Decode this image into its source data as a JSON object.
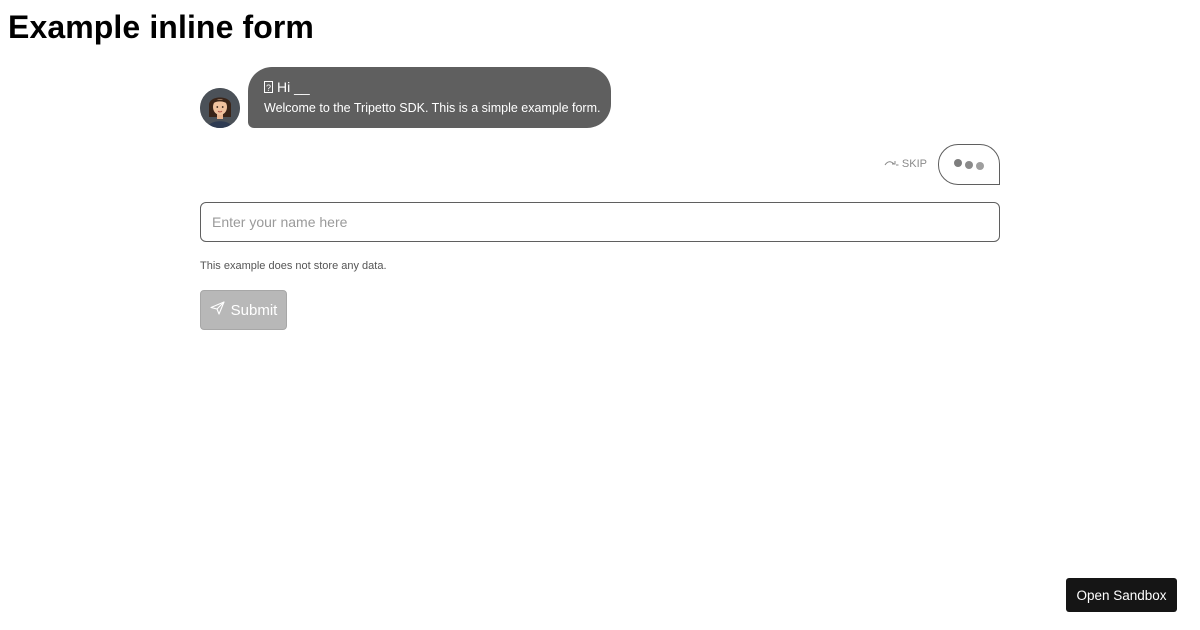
{
  "page": {
    "title": "Example inline form"
  },
  "form": {
    "bubble": {
      "greeting_glyph": "?",
      "greeting": "Hi __",
      "welcome": "Welcome to the Tripetto SDK. This is a simple example form."
    },
    "skip_label": "SKIP",
    "name_input": {
      "placeholder": "Enter your name here",
      "value": ""
    },
    "note": "This example does not store any data.",
    "submit_label": "Submit"
  },
  "sandbox": {
    "label": "Open Sandbox"
  },
  "icons": {
    "avatar": "avatar-icon",
    "skip": "skip-icon",
    "typing": "typing-indicator-icon",
    "submit": "paper-plane-icon"
  },
  "colors": {
    "bubble": "#5f5f5f",
    "submit_disabled": "#b8b8b8",
    "sandbox_button": "#151515"
  }
}
